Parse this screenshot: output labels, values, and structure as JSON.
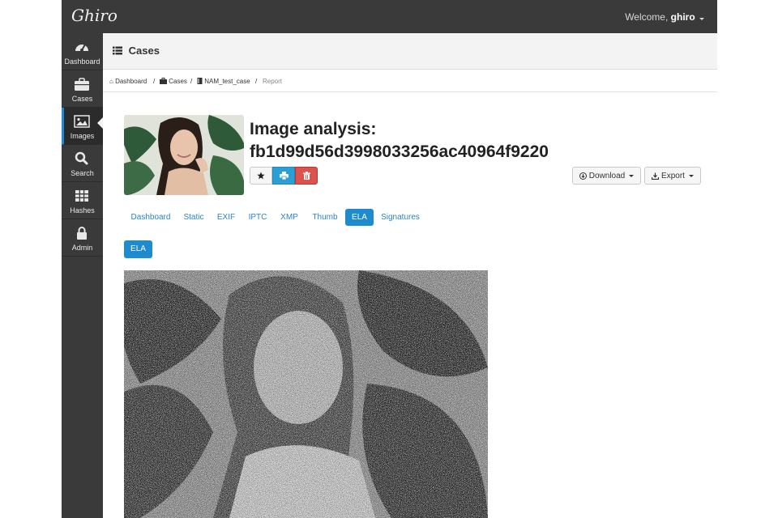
{
  "app": {
    "logo_text": "Ghiro",
    "welcome_prefix": "Welcome, ",
    "username": "ghiro"
  },
  "sidebar": {
    "items": [
      {
        "label": "Dashboard",
        "icon": "dashboard-icon",
        "active": false
      },
      {
        "label": "Cases",
        "icon": "briefcase-icon",
        "active": false
      },
      {
        "label": "Images",
        "icon": "image-icon",
        "active": true
      },
      {
        "label": "Search",
        "icon": "search-icon",
        "active": false
      },
      {
        "label": "Hashes",
        "icon": "table-icon",
        "active": false
      },
      {
        "label": "Admin",
        "icon": "lock-icon",
        "active": false
      }
    ]
  },
  "header": {
    "title": "Cases",
    "icon": "list-icon"
  },
  "breadcrumb": [
    {
      "label": "Dashboard",
      "icon": "home-icon"
    },
    {
      "label": "Cases",
      "icon": "briefcase-icon"
    },
    {
      "label": "NAM_test_case",
      "icon": "book-icon"
    },
    {
      "label": "Report",
      "icon": ""
    }
  ],
  "analysis": {
    "title": "Image analysis:",
    "hash": "fb1d99d56d3998033256ac40964f9220",
    "actions": {
      "favorite_icon": "star-icon",
      "print_icon": "print-icon",
      "delete_icon": "trash-icon"
    },
    "download_label": "Download",
    "export_label": "Export"
  },
  "tabs": [
    {
      "label": "Dashboard",
      "active": false
    },
    {
      "label": "Static",
      "active": false
    },
    {
      "label": "EXIF",
      "active": false
    },
    {
      "label": "IPTC",
      "active": false
    },
    {
      "label": "XMP",
      "active": false
    },
    {
      "label": "Thumb",
      "active": false
    },
    {
      "label": "ELA",
      "active": true
    },
    {
      "label": "Signatures",
      "active": false
    }
  ],
  "ela_section": {
    "pill_label": "ELA"
  },
  "colors": {
    "topbar": "#3a3a3a",
    "accent": "#1e8bcf",
    "danger": "#d9534f",
    "link": "#2a86c4"
  }
}
